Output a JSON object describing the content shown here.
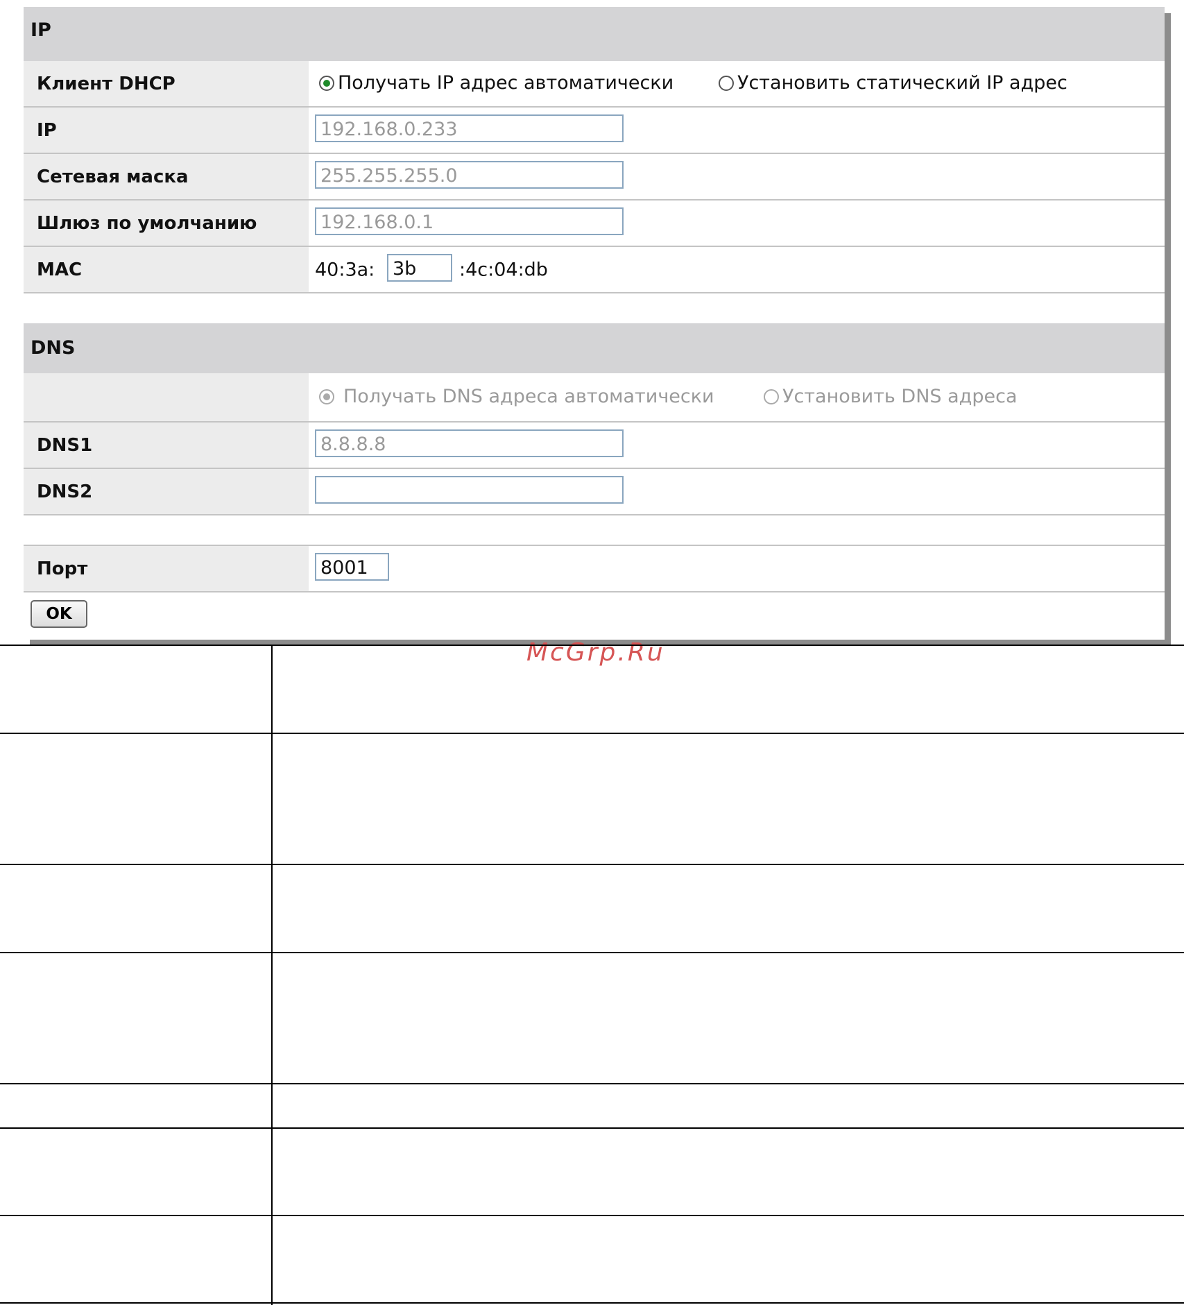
{
  "ip_section": {
    "title": "IP",
    "dhcp": {
      "label": "Клиент DHCP",
      "option_auto": "Получать IP адрес автоматически",
      "option_static": "Установить статический IP адрес"
    },
    "ip": {
      "label": "IP",
      "value": "192.168.0.233"
    },
    "netmask": {
      "label": "Сетевая маска",
      "value": "255.255.255.0"
    },
    "gateway": {
      "label": "Шлюз по умолчанию",
      "value": "192.168.0.1"
    },
    "mac": {
      "label": "MAC",
      "prefix": "40:3a:",
      "editable": "3b",
      "suffix": ":4c:04:db"
    }
  },
  "dns_section": {
    "title": "DNS",
    "option_auto": "Получать DNS адреса автоматически",
    "option_manual": "Установить DNS адреса",
    "dns1": {
      "label": "DNS1",
      "value": "8.8.8.8"
    },
    "dns2": {
      "label": "DNS2",
      "value": ""
    }
  },
  "port": {
    "label": "Порт",
    "value": "8001"
  },
  "ok_button": "OK",
  "watermark": "McGrp.Ru"
}
